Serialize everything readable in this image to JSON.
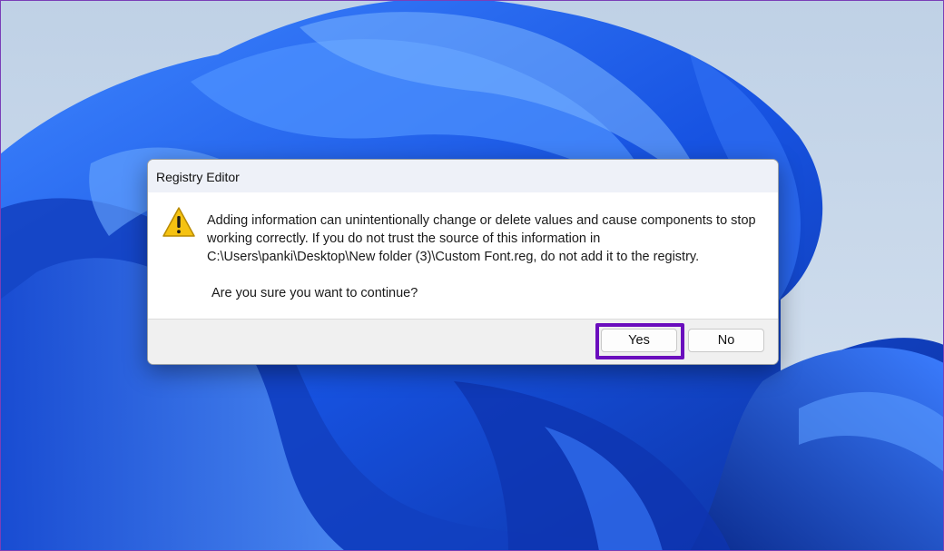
{
  "dialog": {
    "title": "Registry Editor",
    "message": "Adding information can unintentionally change or delete values and cause components to stop working correctly. If you do not trust the source of this information in C:\\Users\\panki\\Desktop\\New folder (3)\\Custom Font.reg, do not add it to the registry.",
    "question": "Are you sure you want to continue?",
    "icon": "warning-icon",
    "buttons": {
      "yes": "Yes",
      "no": "No"
    }
  },
  "colors": {
    "highlight": "#6a0dbd",
    "wallpaper_primary": "#1a5fe8",
    "wallpaper_background": "#c9d9ea",
    "warning_icon": "#f5c211"
  }
}
